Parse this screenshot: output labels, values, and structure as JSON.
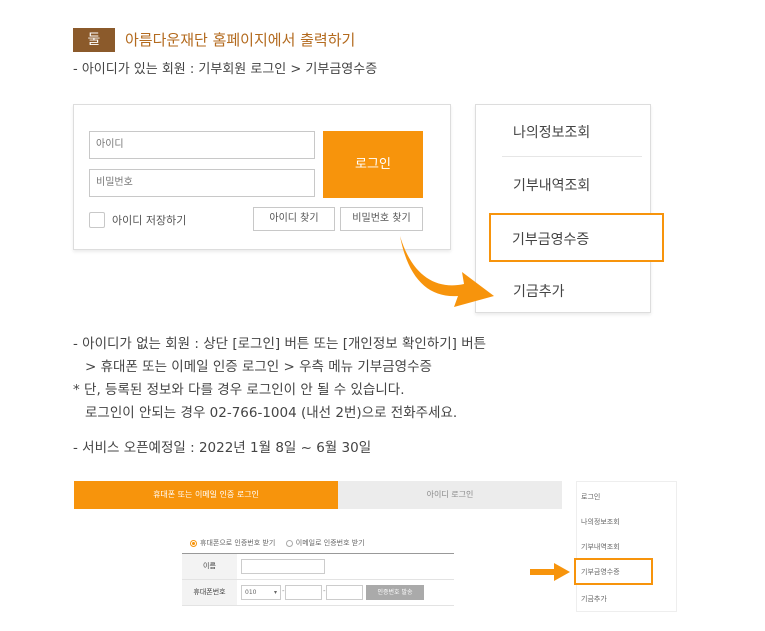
{
  "step": {
    "badge": "둘",
    "title": "아름다운재단 홈페이지에서 출력하기",
    "subtitle": "- 아이디가 있는 회원 : 기부회원 로그인 > 기부금영수증"
  },
  "login_form": {
    "id_placeholder": "아이디",
    "password_placeholder": "비밀번호",
    "login_button": "로그인",
    "save_id_label": "아이디 저장하기",
    "find_id_button": "아이디 찾기",
    "find_password_button": "비밀번호 찾기"
  },
  "side_menu": {
    "items": [
      "나의정보조회",
      "기부내역조회",
      "기부금영수증",
      "기금추가"
    ],
    "highlight_color": "#f7940c"
  },
  "notes": {
    "line1": "- 아이디가 없는 회원 : 상단 [로그인] 버튼 또는 [개인정보 확인하기] 버튼",
    "line2": "> 휴대폰 또는 이메일 인증 로그인 > 우측 메뉴 기부금영수증",
    "line3": "* 단, 등록된 정보와 다를 경우 로그인이 안 될 수 있습니다.",
    "line4": "로그인이 안되는 경우 02-766-1004 (내선 2번)으로 전화주세요.",
    "line5": "- 서비스 오픈예정일 : 2022년 1월 8일 ~ 6월 30일"
  },
  "mini_login": {
    "tab_mobile": "휴대폰 또는 이메일 인증 로그인",
    "tab_id": "아이디 로그인",
    "radio_phone": "휴대폰으로 인증번호 받기",
    "radio_email": "이메일로 인증번호 받기",
    "name_label": "이름",
    "phone_label": "휴대폰번호",
    "phone_prefix": "010",
    "send_code_button": "인증번호 발송"
  },
  "mini_menu": {
    "items": [
      "로그인",
      "나의정보조회",
      "기부내역조회",
      "기부금영수증",
      "기금추가"
    ]
  },
  "colors": {
    "accent": "#f7940c",
    "badge": "#8b5a2b",
    "title": "#b36a1e"
  }
}
